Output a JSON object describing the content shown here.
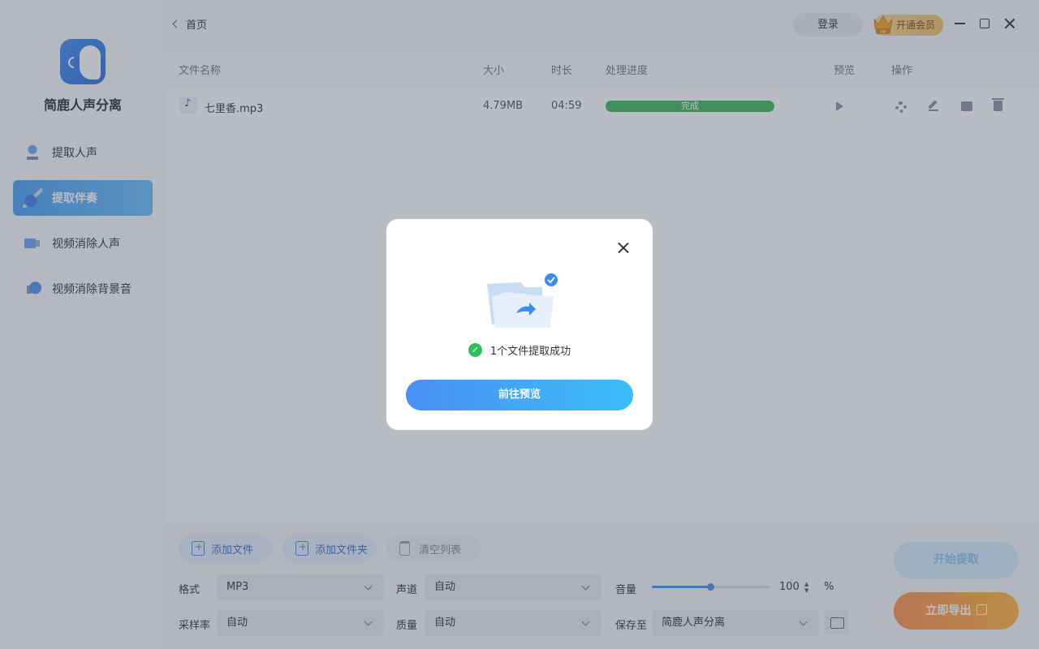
{
  "app": {
    "name": "简鹿人声分离"
  },
  "sidebar": {
    "items": [
      {
        "label": "提取人声",
        "icon": "microphone-icon",
        "active": false
      },
      {
        "label": "提取伴奏",
        "icon": "guitar-icon",
        "active": true
      },
      {
        "label": "视频消除人声",
        "icon": "video-icon",
        "active": false
      },
      {
        "label": "视频消除背景音",
        "icon": "speaker-icon",
        "active": false
      }
    ]
  },
  "header": {
    "breadcrumb": "首页",
    "login_label": "登录",
    "vip_label": "开通会员",
    "crown_text": "VIP"
  },
  "table": {
    "columns": [
      "文件名称",
      "大小",
      "时长",
      "处理进度",
      "预览",
      "操作"
    ],
    "rows": [
      {
        "name": "七里香.mp3",
        "size": "4.79MB",
        "duration": "04:59",
        "status": "完成",
        "progress": 100
      }
    ]
  },
  "actions": {
    "add_file": "添加文件",
    "add_folder": "添加文件夹",
    "clear_list": "清空列表"
  },
  "settings": {
    "format_label": "格式",
    "format_value": "MP3",
    "channel_label": "声道",
    "channel_value": "自动",
    "volume_label": "音量",
    "volume_value": "100",
    "volume_unit": "%",
    "volume_fraction": 0.49,
    "samplerate_label": "采样率",
    "samplerate_value": "自动",
    "quality_label": "质量",
    "quality_value": "自动",
    "saveto_label": "保存至",
    "saveto_value": "简鹿人声分离"
  },
  "buttons": {
    "start": "开始提取",
    "export": "立即导出"
  },
  "modal": {
    "message": "1个文件提取成功",
    "primary": "前往预览"
  },
  "colors": {
    "accent": "#4a8ff5",
    "success": "#3cb55a",
    "export": "#ff9a42"
  }
}
